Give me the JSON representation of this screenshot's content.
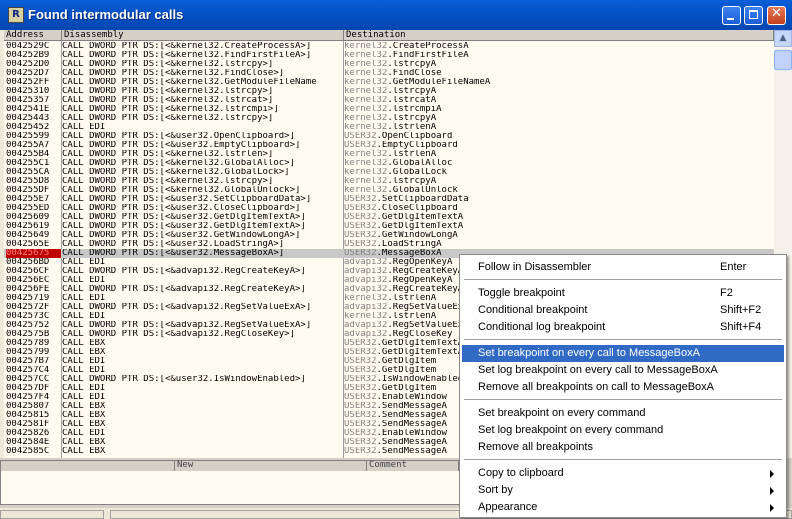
{
  "window": {
    "title": "Found intermodular calls",
    "icon_letter": "R"
  },
  "columns": {
    "address": "Address",
    "disassembly": "Disassembly",
    "destination": "Destination"
  },
  "rows": [
    {
      "a": "0042529C",
      "d": "CALL DWORD PTR DS:[<&kernel32.CreateProcessA>]",
      "m": "kernel32",
      "f": ".CreateProcessA"
    },
    {
      "a": "004252B9",
      "d": "CALL DWORD PTR DS:[<&kernel32.FindFirstFileA>]",
      "m": "kernel32",
      "f": ".FindFirstFileA"
    },
    {
      "a": "004252D0",
      "d": "CALL DWORD PTR DS:[<&kernel32.lstrcpy>]",
      "m": "kernel32",
      "f": ".lstrcpyA"
    },
    {
      "a": "004252D7",
      "d": "CALL DWORD PTR DS:[<&kernel32.FindClose>]",
      "m": "kernel32",
      "f": ".FindClose"
    },
    {
      "a": "004252FF",
      "d": "CALL DWORD PTR DS:[<&kernel32.GetModuleFileName",
      "m": "kernel32",
      "f": ".GetModuleFileNameA"
    },
    {
      "a": "00425310",
      "d": "CALL DWORD PTR DS:[<&kernel32.lstrcpy>]",
      "m": "kernel32",
      "f": ".lstrcpyA"
    },
    {
      "a": "00425357",
      "d": "CALL DWORD PTR DS:[<&kernel32.lstrcat>]",
      "m": "kernel32",
      "f": ".lstrcatA"
    },
    {
      "a": "0042541E",
      "d": "CALL DWORD PTR DS:[<&kernel32.lstrcmpi>]",
      "m": "kernel32",
      "f": ".lstrcmpiA"
    },
    {
      "a": "00425443",
      "d": "CALL DWORD PTR DS:[<&kernel32.lstrcpy>]",
      "m": "kernel32",
      "f": ".lstrcpyA"
    },
    {
      "a": "00425452",
      "d": "CALL EDI",
      "m": "kernel32",
      "f": ".lstrlenA"
    },
    {
      "a": "00425599",
      "d": "CALL DWORD PTR DS:[<&user32.OpenClipboard>]",
      "m": "USER32",
      "f": ".OpenClipboard"
    },
    {
      "a": "004255A7",
      "d": "CALL DWORD PTR DS:[<&user32.EmptyClipboard>]",
      "m": "USER32",
      "f": ".EmptyClipboard"
    },
    {
      "a": "004255B4",
      "d": "CALL DWORD PTR DS:[<&kernel32.lstrlen>]",
      "m": "kernel32",
      "f": ".lstrlenA"
    },
    {
      "a": "004255C1",
      "d": "CALL DWORD PTR DS:[<&kernel32.GlobalAlloc>]",
      "m": "kernel32",
      "f": ".GlobalAlloc"
    },
    {
      "a": "004255CA",
      "d": "CALL DWORD PTR DS:[<&kernel32.GlobalLock>]",
      "m": "kernel32",
      "f": ".GlobalLock"
    },
    {
      "a": "004255D8",
      "d": "CALL DWORD PTR DS:[<&kernel32.lstrcpy>]",
      "m": "kernel32",
      "f": ".lstrcpyA"
    },
    {
      "a": "004255DF",
      "d": "CALL DWORD PTR DS:[<&kernel32.GlobalUnlock>]",
      "m": "kernel32",
      "f": ".GlobalUnlock"
    },
    {
      "a": "004255E7",
      "d": "CALL DWORD PTR DS:[<&user32.SetClipboardData>]",
      "m": "USER32",
      "f": ".SetClipboardData"
    },
    {
      "a": "004255ED",
      "d": "CALL DWORD PTR DS:[<&user32.CloseClipboard>]",
      "m": "USER32",
      "f": ".CloseClipboard"
    },
    {
      "a": "00425609",
      "d": "CALL DWORD PTR DS:[<&user32.GetDlgItemTextA>]",
      "m": "USER32",
      "f": ".GetDlgItemTextA"
    },
    {
      "a": "00425619",
      "d": "CALL DWORD PTR DS:[<&user32.GetDlgItemTextA>]",
      "m": "USER32",
      "f": ".GetDlgItemTextA"
    },
    {
      "a": "00425649",
      "d": "CALL DWORD PTR DS:[<&user32.GetWindowLongA>]",
      "m": "USER32",
      "f": ".GetWindowLongA"
    },
    {
      "a": "0042565E",
      "d": "CALL DWORD PTR DS:[<&user32.LoadStringA>]",
      "m": "USER32",
      "f": ".LoadStringA"
    },
    {
      "a": "00425675",
      "d": "CALL DWORD PTR DS:[<&user32.MessageBoxA>]",
      "m": "USER32",
      "f": ".MessageBoxA"
    },
    {
      "a": "004256BD",
      "d": "CALL EDI",
      "m": "advapi32",
      "f": ".RegOpenKeyA"
    },
    {
      "a": "004256CF",
      "d": "CALL DWORD PTR DS:[<&advapi32.RegCreateKeyA>]",
      "m": "advapi32",
      "f": ".RegCreateKeyA"
    },
    {
      "a": "004256EC",
      "d": "CALL EDI",
      "m": "advapi32",
      "f": ".RegOpenKeyA"
    },
    {
      "a": "004256FE",
      "d": "CALL DWORD PTR DS:[<&advapi32.RegCreateKeyA>]",
      "m": "advapi32",
      "f": ".RegCreateKeyA"
    },
    {
      "a": "00425719",
      "d": "CALL EDI",
      "m": "kernel32",
      "f": ".lstrlenA"
    },
    {
      "a": "0042572F",
      "d": "CALL DWORD PTR DS:[<&advapi32.RegSetValueExA>]",
      "m": "advapi32",
      "f": ".RegSetValueExA"
    },
    {
      "a": "0042573C",
      "d": "CALL EDI",
      "m": "kernel32",
      "f": ".lstrlenA"
    },
    {
      "a": "00425752",
      "d": "CALL DWORD PTR DS:[<&advapi32.RegSetValueExA>]",
      "m": "advapi32",
      "f": ".RegSetValueExA"
    },
    {
      "a": "0042575B",
      "d": "CALL DWORD PTR DS:[<&advapi32.RegCloseKey>]",
      "m": "advapi32",
      "f": ".RegCloseKey"
    },
    {
      "a": "00425789",
      "d": "CALL EBX",
      "m": "USER32",
      "f": ".GetDlgItemTextA"
    },
    {
      "a": "00425799",
      "d": "CALL EBX",
      "m": "USER32",
      "f": ".GetDlgItemTextA"
    },
    {
      "a": "004257B7",
      "d": "CALL EDI",
      "m": "USER32",
      "f": ".GetDlgItem"
    },
    {
      "a": "004257C4",
      "d": "CALL EDI",
      "m": "USER32",
      "f": ".GetDlgItem"
    },
    {
      "a": "004257CC",
      "d": "CALL DWORD PTR DS:[<&user32.IsWindowEnabled>]",
      "m": "USER32",
      "f": ".IsWindowEnabled"
    },
    {
      "a": "004257DF",
      "d": "CALL EDI",
      "m": "USER32",
      "f": ".GetDlgItem"
    },
    {
      "a": "004257F4",
      "d": "CALL EDI",
      "m": "USER32",
      "f": ".EnableWindow"
    },
    {
      "a": "00425807",
      "d": "CALL EBX",
      "m": "USER32",
      "f": ".SendMessageA"
    },
    {
      "a": "00425815",
      "d": "CALL EBX",
      "m": "USER32",
      "f": ".SendMessageA"
    },
    {
      "a": "0042581F",
      "d": "CALL EBX",
      "m": "USER32",
      "f": ".SendMessageA"
    },
    {
      "a": "00425826",
      "d": "CALL EDI",
      "m": "USER32",
      "f": ".EnableWindow"
    },
    {
      "a": "0042584E",
      "d": "CALL EBX",
      "m": "USER32",
      "f": ".SendMessageA"
    },
    {
      "a": "0042585C",
      "d": "CALL EBX",
      "m": "USER32",
      "f": ".SendMessageA"
    }
  ],
  "selected_row_index": 23,
  "lower_panel": {
    "col_new": "New",
    "col_comment": "Comment"
  },
  "context_menu": {
    "items": [
      {
        "label": "Follow in Disassembler",
        "shortcut": "Enter"
      },
      {
        "label": "Toggle breakpoint",
        "shortcut": "F2"
      },
      {
        "label": "Conditional breakpoint",
        "shortcut": "Shift+F2"
      },
      {
        "label": "Conditional log breakpoint",
        "shortcut": "Shift+F4"
      },
      {
        "label": "Set breakpoint on every call to MessageBoxA",
        "shortcut": ""
      },
      {
        "label": "Set log breakpoint on every call to MessageBoxA",
        "shortcut": ""
      },
      {
        "label": "Remove all breakpoints on call to MessageBoxA",
        "shortcut": ""
      },
      {
        "label": "Set breakpoint on every command",
        "shortcut": ""
      },
      {
        "label": "Set log breakpoint on every command",
        "shortcut": ""
      },
      {
        "label": "Remove all breakpoints",
        "shortcut": ""
      },
      {
        "label": "Copy to clipboard",
        "shortcut": ""
      },
      {
        "label": "Sort by",
        "shortcut": ""
      },
      {
        "label": "Appearance",
        "shortcut": ""
      }
    ],
    "active_index": 4
  },
  "colors": {
    "titlebar": "#0553c6",
    "selection": "#316ac5",
    "selected_address_bg": "#c00000",
    "list_bg": "#fffbf0"
  }
}
